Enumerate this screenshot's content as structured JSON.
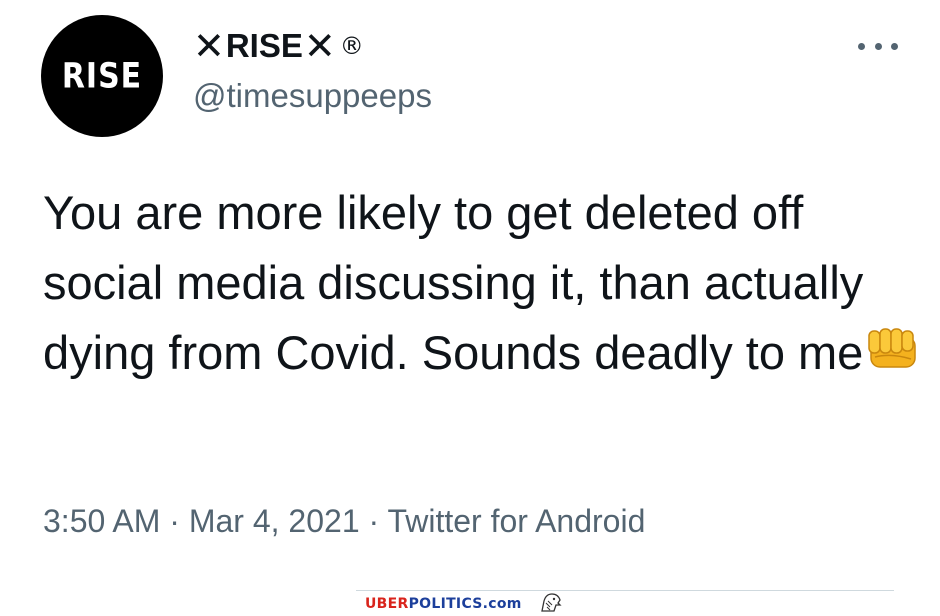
{
  "author": {
    "avatar_text": "RISE",
    "display_name_prefix": "✕",
    "display_name": "RISE",
    "display_name_suffix": "✕",
    "display_name_mark": "®",
    "handle": "@timesuppeeps"
  },
  "menu": {
    "icon": "more-horizontal-icon"
  },
  "tweet": {
    "text": "You are more likely to get deleted off social media discussing it, than actually dying from Covid. Sounds deadly to me",
    "emoji": "oncoming-fist-icon"
  },
  "meta": {
    "time": "3:50 AM",
    "separator_1": " · ",
    "date": "Mar 4, 2021",
    "separator_2": " · ",
    "source": "Twitter for Android"
  },
  "watermark": {
    "part_red": "UBER",
    "part_blue": "POLITICS.com",
    "icon": "eagle-icon"
  },
  "colors": {
    "text_primary": "#0f1419",
    "text_secondary": "#536471",
    "avatar_bg": "#000000",
    "watermark_red": "#d9241c",
    "watermark_blue": "#1c3f9b"
  }
}
